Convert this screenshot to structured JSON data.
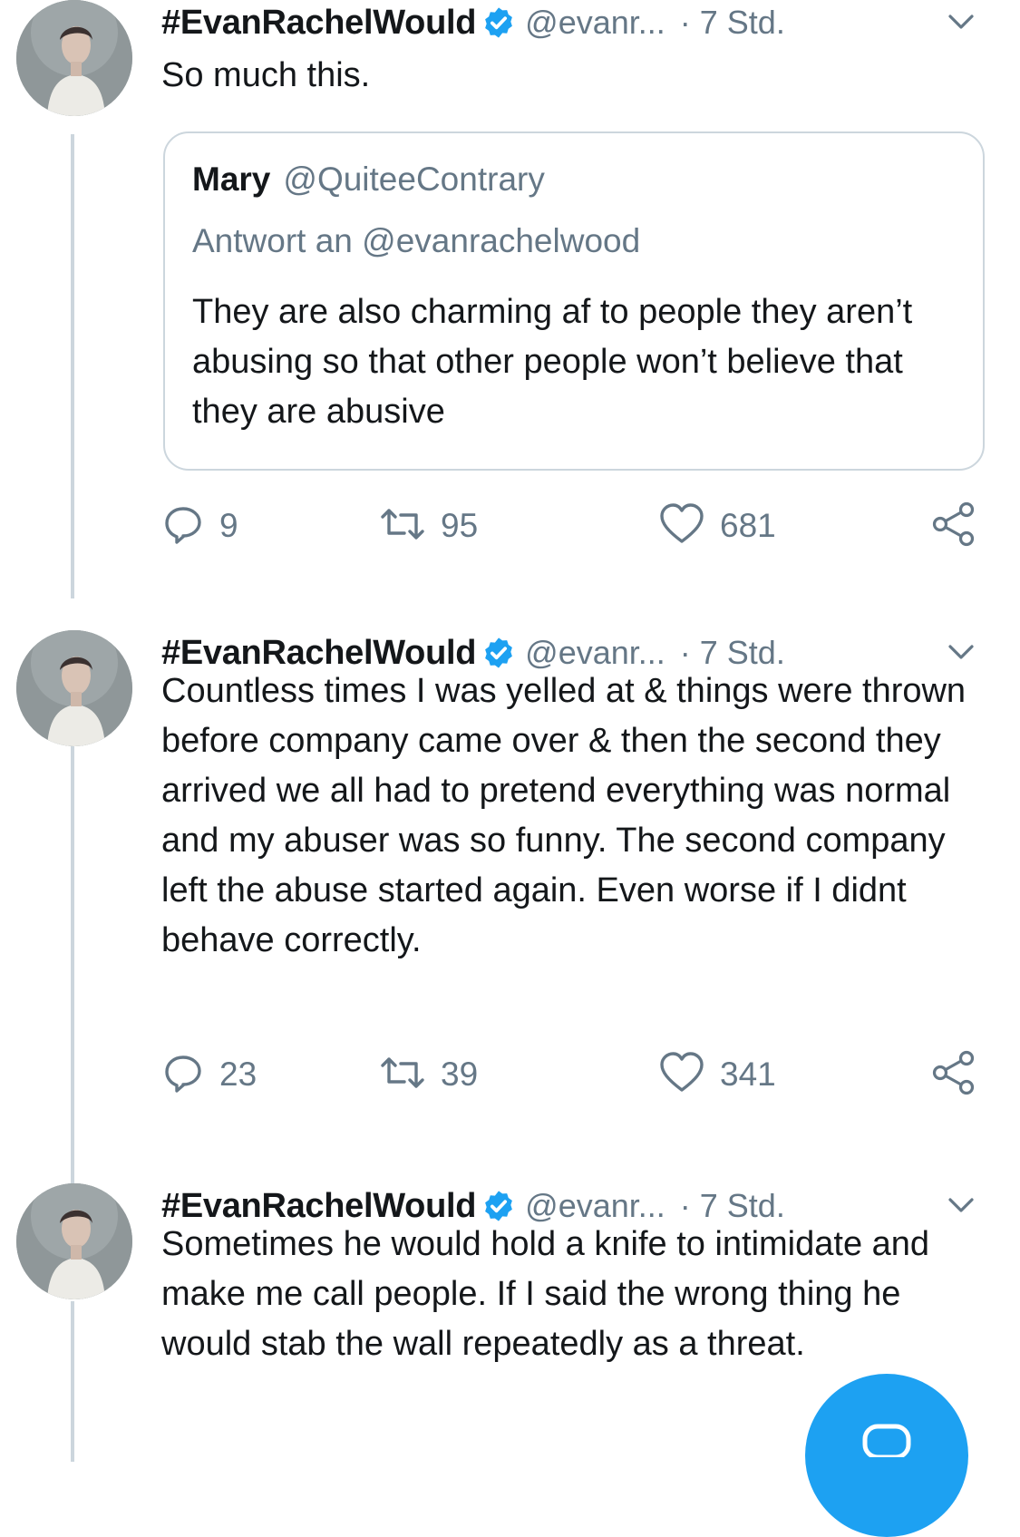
{
  "colors": {
    "accent": "#1da1f2",
    "text": "#14171a",
    "muted": "#657786",
    "border": "#ccd6dd"
  },
  "tweets": [
    {
      "display_name": "#EvanRachelWould",
      "verified_icon": "verified-badge-icon",
      "handle": "@evanr...",
      "time": "· 7 Std.",
      "text": "So much this.",
      "quote": {
        "name": "Mary",
        "handle": "@QuiteeContrary",
        "reply_to": "Antwort an @evanrachelwood",
        "text": "They are also charming af to people they aren’t abusing so that other people won’t believe that they are abusive"
      },
      "replies": "9",
      "retweets": "95",
      "likes": "681"
    },
    {
      "display_name": "#EvanRachelWould",
      "verified_icon": "verified-badge-icon",
      "handle": "@evanr...",
      "time": "· 7 Std.",
      "text": "Countless times I was yelled at & things were thrown before company came over & then the second they arrived we all had to pretend everything was normal and my abuser was so funny. The second company left the abuse started again. Even worse if I didnt behave correctly.",
      "replies": "23",
      "retweets": "39",
      "likes": "341"
    },
    {
      "display_name": "#EvanRachelWould",
      "verified_icon": "verified-badge-icon",
      "handle": "@evanr...",
      "time": "· 7 Std.",
      "text": "Sometimes he would hold a knife to intimidate and make me call people. If I said the wrong thing he would stab the wall repeatedly as a threat."
    }
  ],
  "fab_icon": "compose-tweet-icon"
}
